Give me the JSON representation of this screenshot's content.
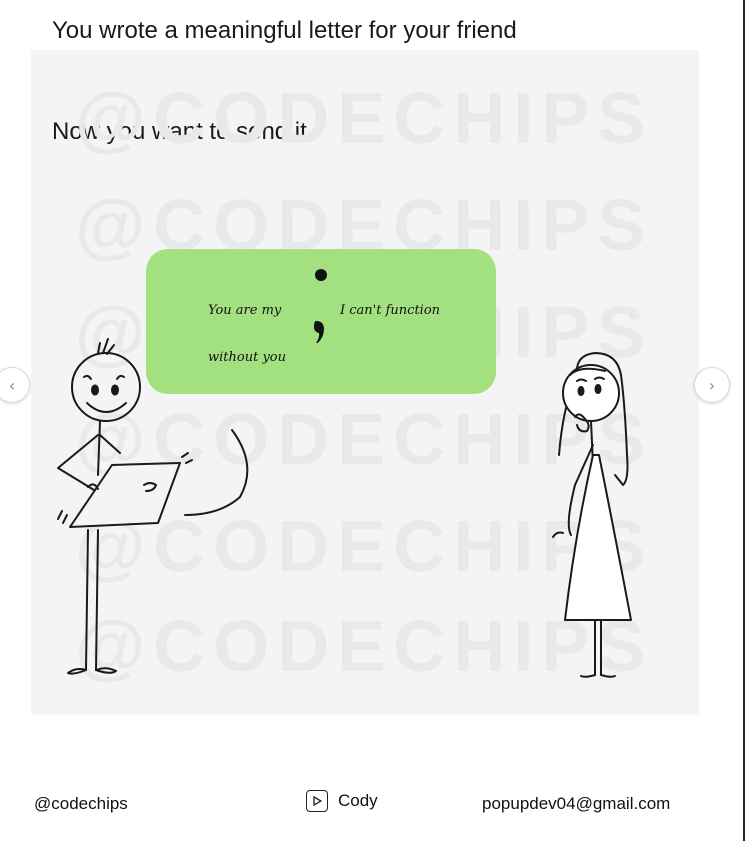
{
  "slide": {
    "title": "You wrote a meaningful letter for your friend",
    "subtitle": "Now you want to send it",
    "watermark": "@CODECHIPS",
    "bubble": {
      "text_left": "You are my",
      "text_right": "I can't function",
      "text_bottom": "without you",
      "color": "#a3e07f"
    }
  },
  "carousel": {
    "prev_icon": "chevron-left-icon",
    "next_icon": "chevron-right-icon"
  },
  "footer": {
    "handle": "@codechips",
    "author": "Cody",
    "author_icon": "play-icon",
    "email": "popupdev04@gmail.com"
  }
}
